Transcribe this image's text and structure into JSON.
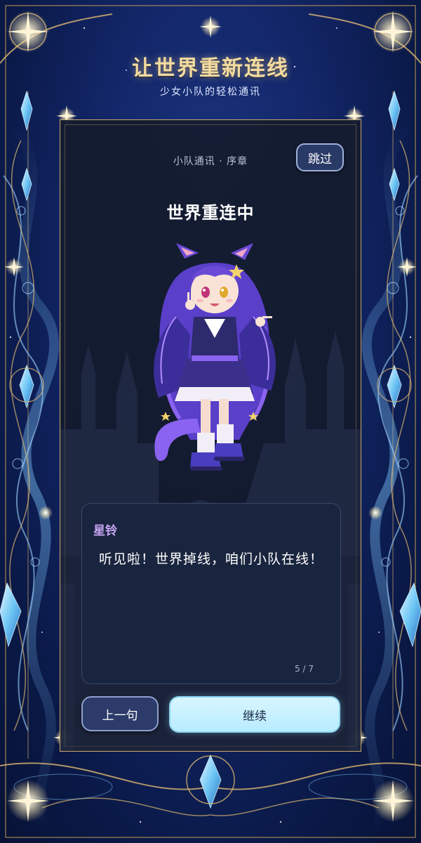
{
  "header": {
    "title": "让世界重新连线",
    "subtitle": "少女小队的轻松通讯"
  },
  "panel": {
    "label": "小队通讯 · 序章",
    "skip_label": "跳过",
    "scene_title": "世界重连中"
  },
  "dialog": {
    "speaker": "星铃",
    "text": "听见啦！世界掉线，咱们小队在线！",
    "page": "5 / 7"
  },
  "controls": {
    "prev_label": "上一句",
    "continue_label": "继续"
  },
  "colors": {
    "accent_gold": "#f3dba0",
    "speaker_purple": "#c7a6f2",
    "continue_bg": "#c8f0ff"
  }
}
